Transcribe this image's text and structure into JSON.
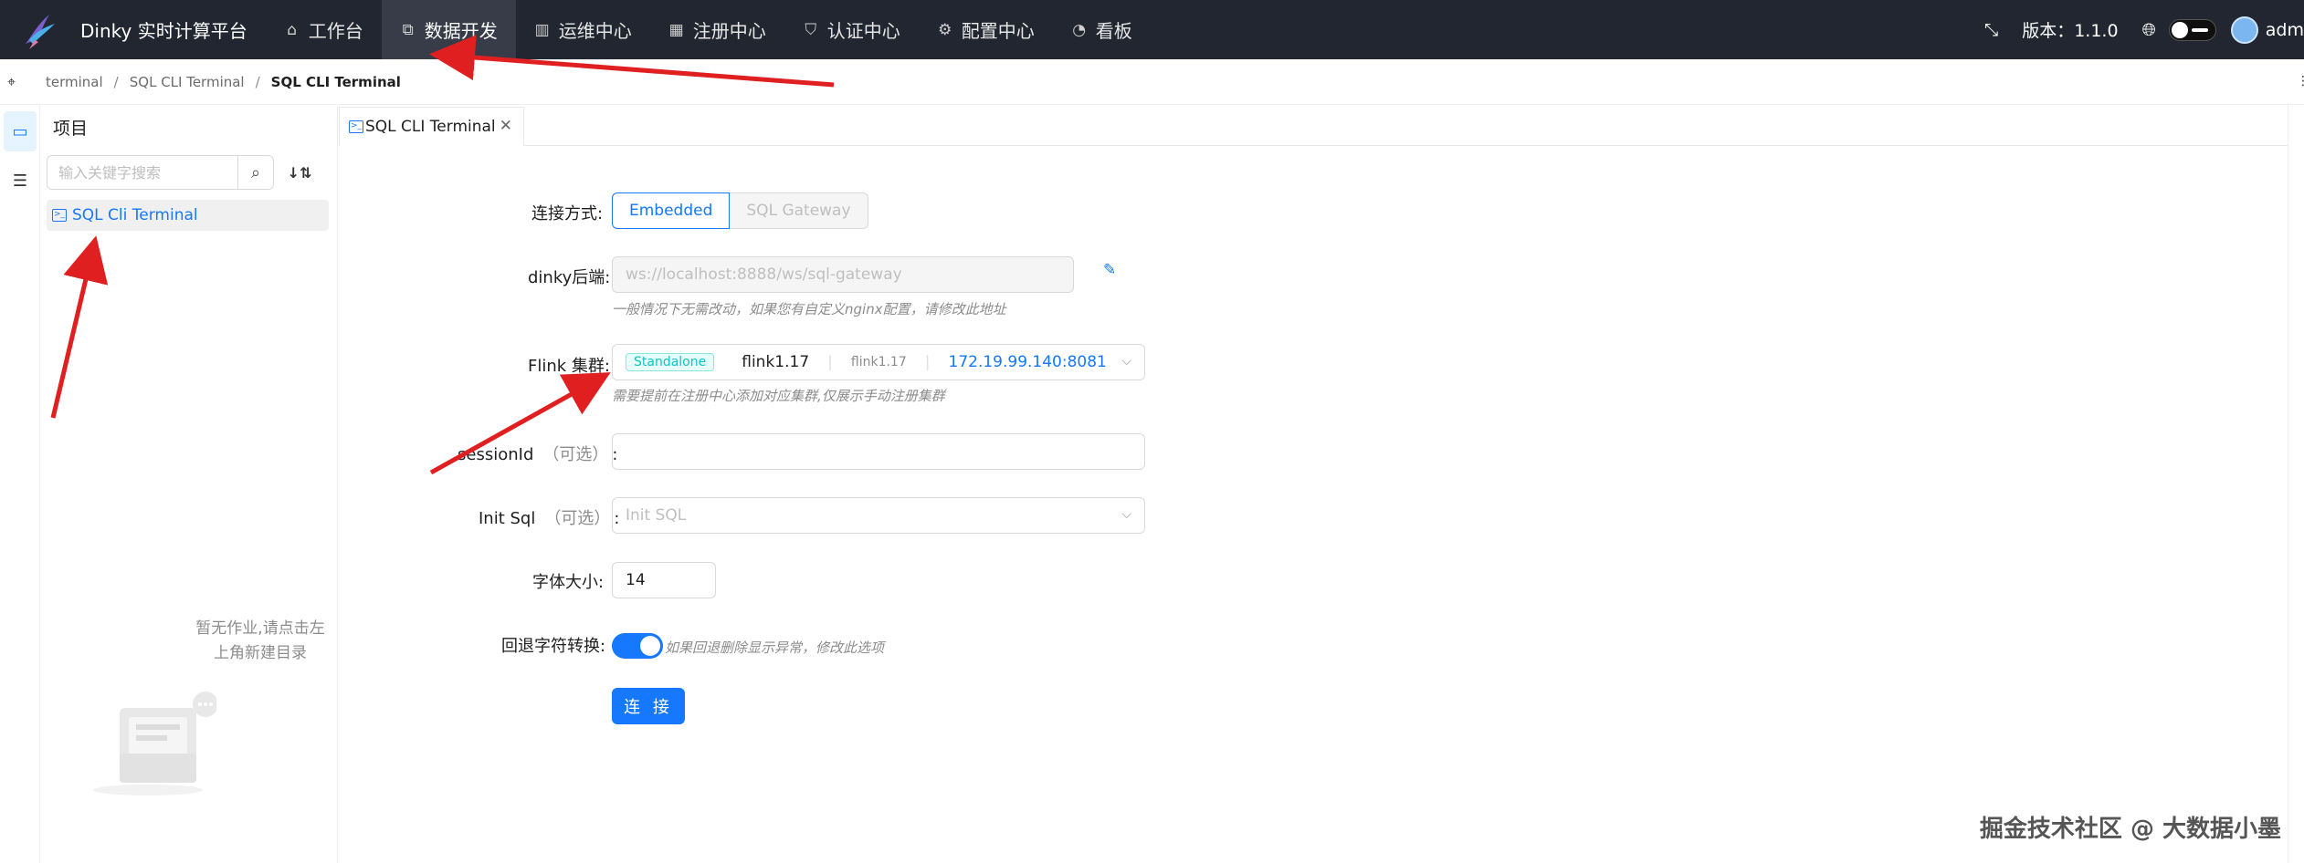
{
  "header": {
    "app_title": "Dinky 实时计算平台",
    "nav": [
      {
        "label": "工作台",
        "icon": "home-icon"
      },
      {
        "label": "数据开发",
        "icon": "code-icon"
      },
      {
        "label": "运维中心",
        "icon": "dashboard-icon"
      },
      {
        "label": "注册中心",
        "icon": "app-icon"
      },
      {
        "label": "认证中心",
        "icon": "shield-icon"
      },
      {
        "label": "配置中心",
        "icon": "gear-icon"
      },
      {
        "label": "看板",
        "icon": "gauge-icon"
      }
    ],
    "version_label": "版本：1.1.0",
    "user_name": "adm"
  },
  "breadcrumb": [
    "terminal",
    "SQL CLI Terminal",
    "SQL CLI Terminal"
  ],
  "panel": {
    "title": "项目",
    "search_placeholder": "输入关键字搜索",
    "tree_item": "SQL Cli Terminal",
    "empty_text_line1": "暂无作业,请点击左",
    "empty_text_line2": "上角新建目录"
  },
  "tab": {
    "label": "SQL CLI Terminal"
  },
  "form": {
    "mode_label": "连接方式",
    "mode_options": [
      "Embedded",
      "SQL Gateway"
    ],
    "mode_selected": "Embedded",
    "backend_label": "dinky后端",
    "backend_value": "ws://localhost:8888/ws/sql-gateway",
    "backend_hint": "一般情况下无需改动，如果您有自定义nginx配置，请修改此地址",
    "cluster_label": "Flink 集群",
    "cluster_tag": "Standalone",
    "cluster_name": "flink1.17",
    "cluster_version": "flink1.17",
    "cluster_address": "172.19.99.140:8081",
    "cluster_hint": "需要提前在注册中心添加对应集群,仅展示手动注册集群",
    "session_label": "sessionId",
    "session_optional": "（可选）",
    "session_value": "",
    "initsql_label": "Init Sql",
    "initsql_optional": "（可选）",
    "initsql_placeholder": "Init SQL",
    "fontsize_label": "字体大小",
    "fontsize_value": "14",
    "backspace_label": "回退字符转换",
    "backspace_on": true,
    "backspace_hint": "如果回退删除显示异常，修改此选项",
    "connect_label": "连 接"
  },
  "watermark": "掘金技术社区 @ 大数据小墨",
  "colors": {
    "primary": "#1677ff",
    "header_bg": "#222631",
    "arrow": "#e02020",
    "tag": "#13c2c2"
  }
}
